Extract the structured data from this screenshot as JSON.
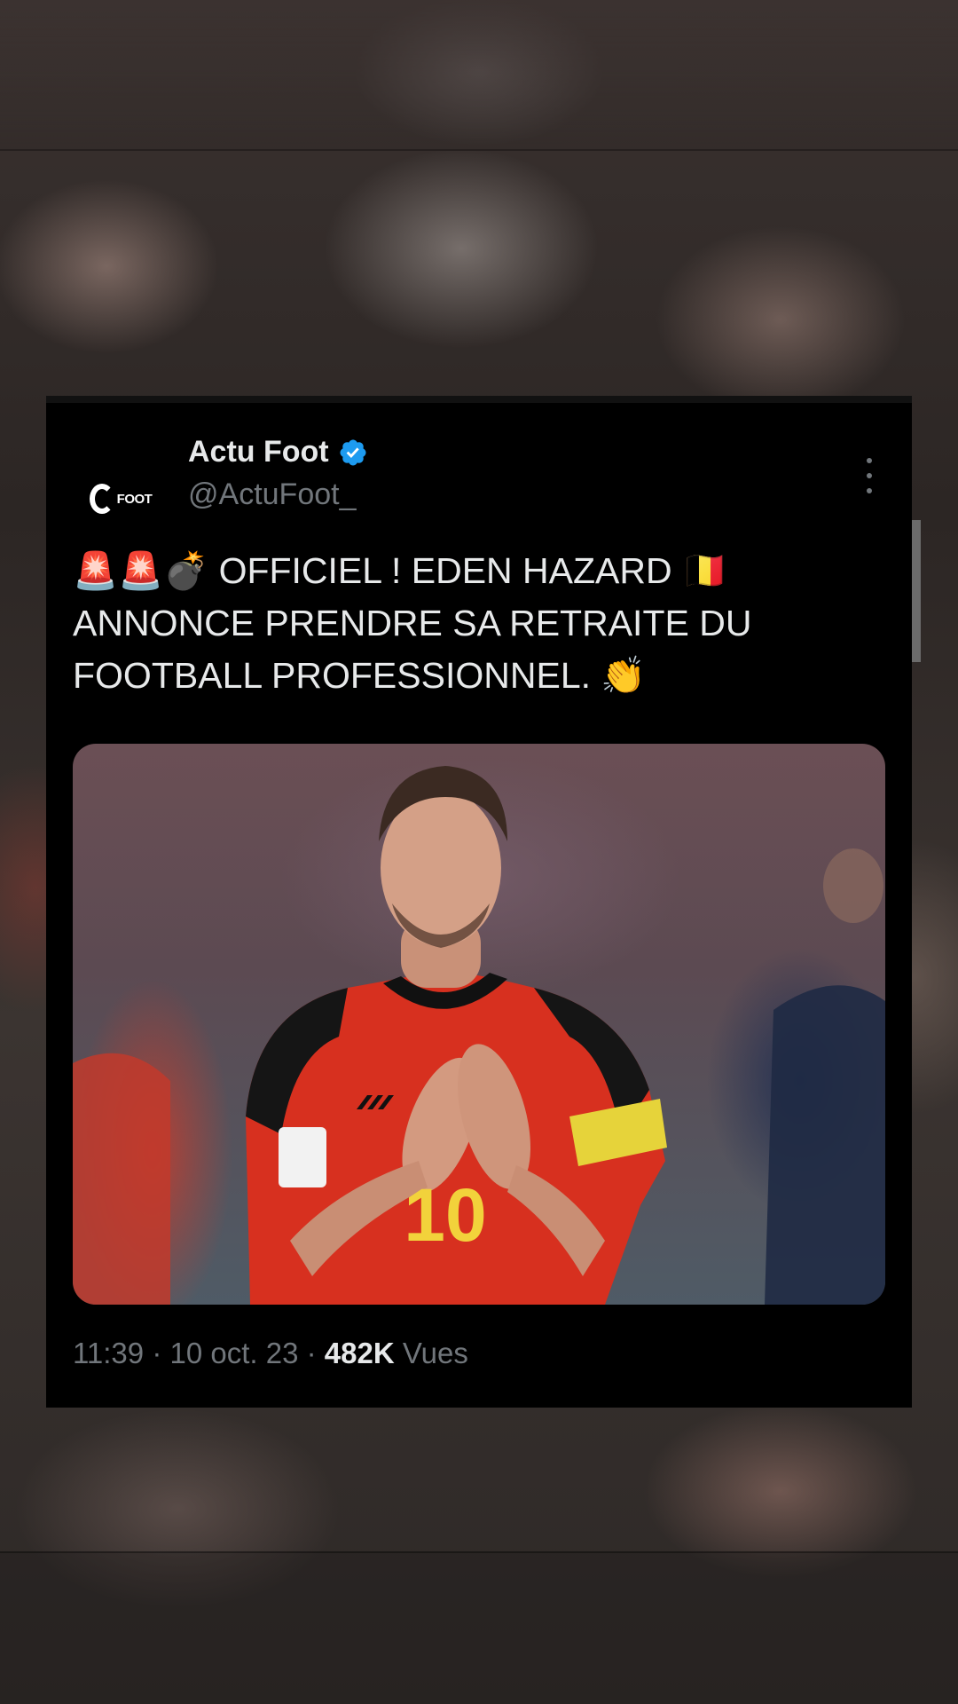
{
  "tweet": {
    "display_name": "Actu Foot",
    "handle": "@ActuFoot_",
    "avatar_text": "FOOT",
    "text_line1_emoji": "🚨🚨💣",
    "text_line1": "OFFICIEL ! EDEN HAZARD",
    "text_flag": "🇧🇪",
    "text_line2": "ANNONCE PRENDRE SA RETRAITE DU",
    "text_line3": "FOOTBALL PROFESSIONNEL.",
    "text_line3_emoji": "👏",
    "media_jersey_number": "10",
    "time": "11:39",
    "separator": "·",
    "date": "10 oct. 23",
    "views_count": "482K",
    "views_label": "Vues"
  },
  "colors": {
    "card_bg": "#000000",
    "primary_text": "#e7e9ea",
    "secondary_text": "#71767b",
    "verified_blue": "#1d9bf0"
  },
  "icons": {
    "verified": "verified-badge-icon",
    "more": "more-vertical-icon"
  }
}
